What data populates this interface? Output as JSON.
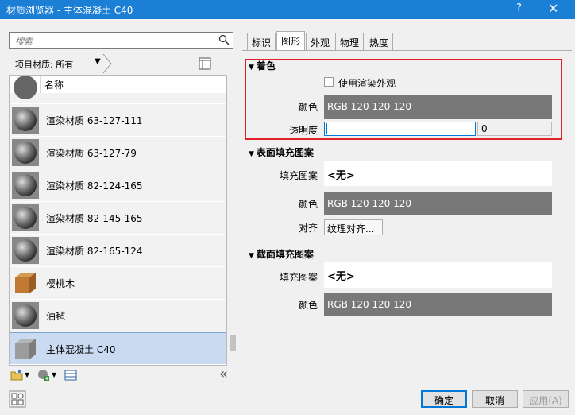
{
  "window": {
    "title": "材质浏览器 - 主体混凝土 C40",
    "help_glyph": "?",
    "close_glyph": "✕"
  },
  "search": {
    "placeholder": "搜索"
  },
  "filter": {
    "label": "项目材质: 所有",
    "chevron": "▼"
  },
  "list": {
    "column_header": "名称",
    "rows": [
      {
        "label": "渲染材质 63-127-111",
        "thumb": "sphere-icon"
      },
      {
        "label": "渲染材质 63-127-79",
        "thumb": "sphere-icon"
      },
      {
        "label": "渲染材质 82-124-165",
        "thumb": "sphere-icon"
      },
      {
        "label": "渲染材质 82-145-165",
        "thumb": "sphere-icon"
      },
      {
        "label": "渲染材质 82-165-124",
        "thumb": "sphere-icon"
      },
      {
        "label": "樱桃木",
        "thumb": "wood-cube-icon"
      },
      {
        "label": "油毡",
        "thumb": "sphere-icon"
      },
      {
        "label": "主体混凝土 C40",
        "thumb": "concrete-cube-icon"
      }
    ],
    "selected_index": 7
  },
  "tabs": [
    {
      "label": "标识"
    },
    {
      "label": "图形"
    },
    {
      "label": "外观"
    },
    {
      "label": "物理"
    },
    {
      "label": "热度"
    }
  ],
  "active_tab": 1,
  "shading": {
    "heading": "着色",
    "use_render_appearance": "使用渲染外观",
    "color_label": "颜色",
    "color_value": "RGB 120 120 120",
    "transparency_label": "透明度",
    "transparency_value": "0"
  },
  "surface_pattern": {
    "heading": "表面填充图案",
    "pattern_label": "填充图案",
    "pattern_value": "<无>",
    "color_label": "颜色",
    "color_value": "RGB 120 120 120",
    "align_label": "对齐",
    "align_button": "纹理对齐..."
  },
  "cut_pattern": {
    "heading": "截面填充图案",
    "pattern_label": "填充图案",
    "pattern_value": "<无>",
    "color_label": "颜色",
    "color_value": "RGB 120 120 120"
  },
  "buttons": {
    "ok": "确定",
    "cancel": "取消",
    "apply": "应用(A)"
  },
  "collapse_glyph": "«",
  "colors": {
    "titlebar": "#1c7fd6",
    "swatch": "#787878",
    "highlight": "#e0202a",
    "selection": "#c9daf1"
  }
}
